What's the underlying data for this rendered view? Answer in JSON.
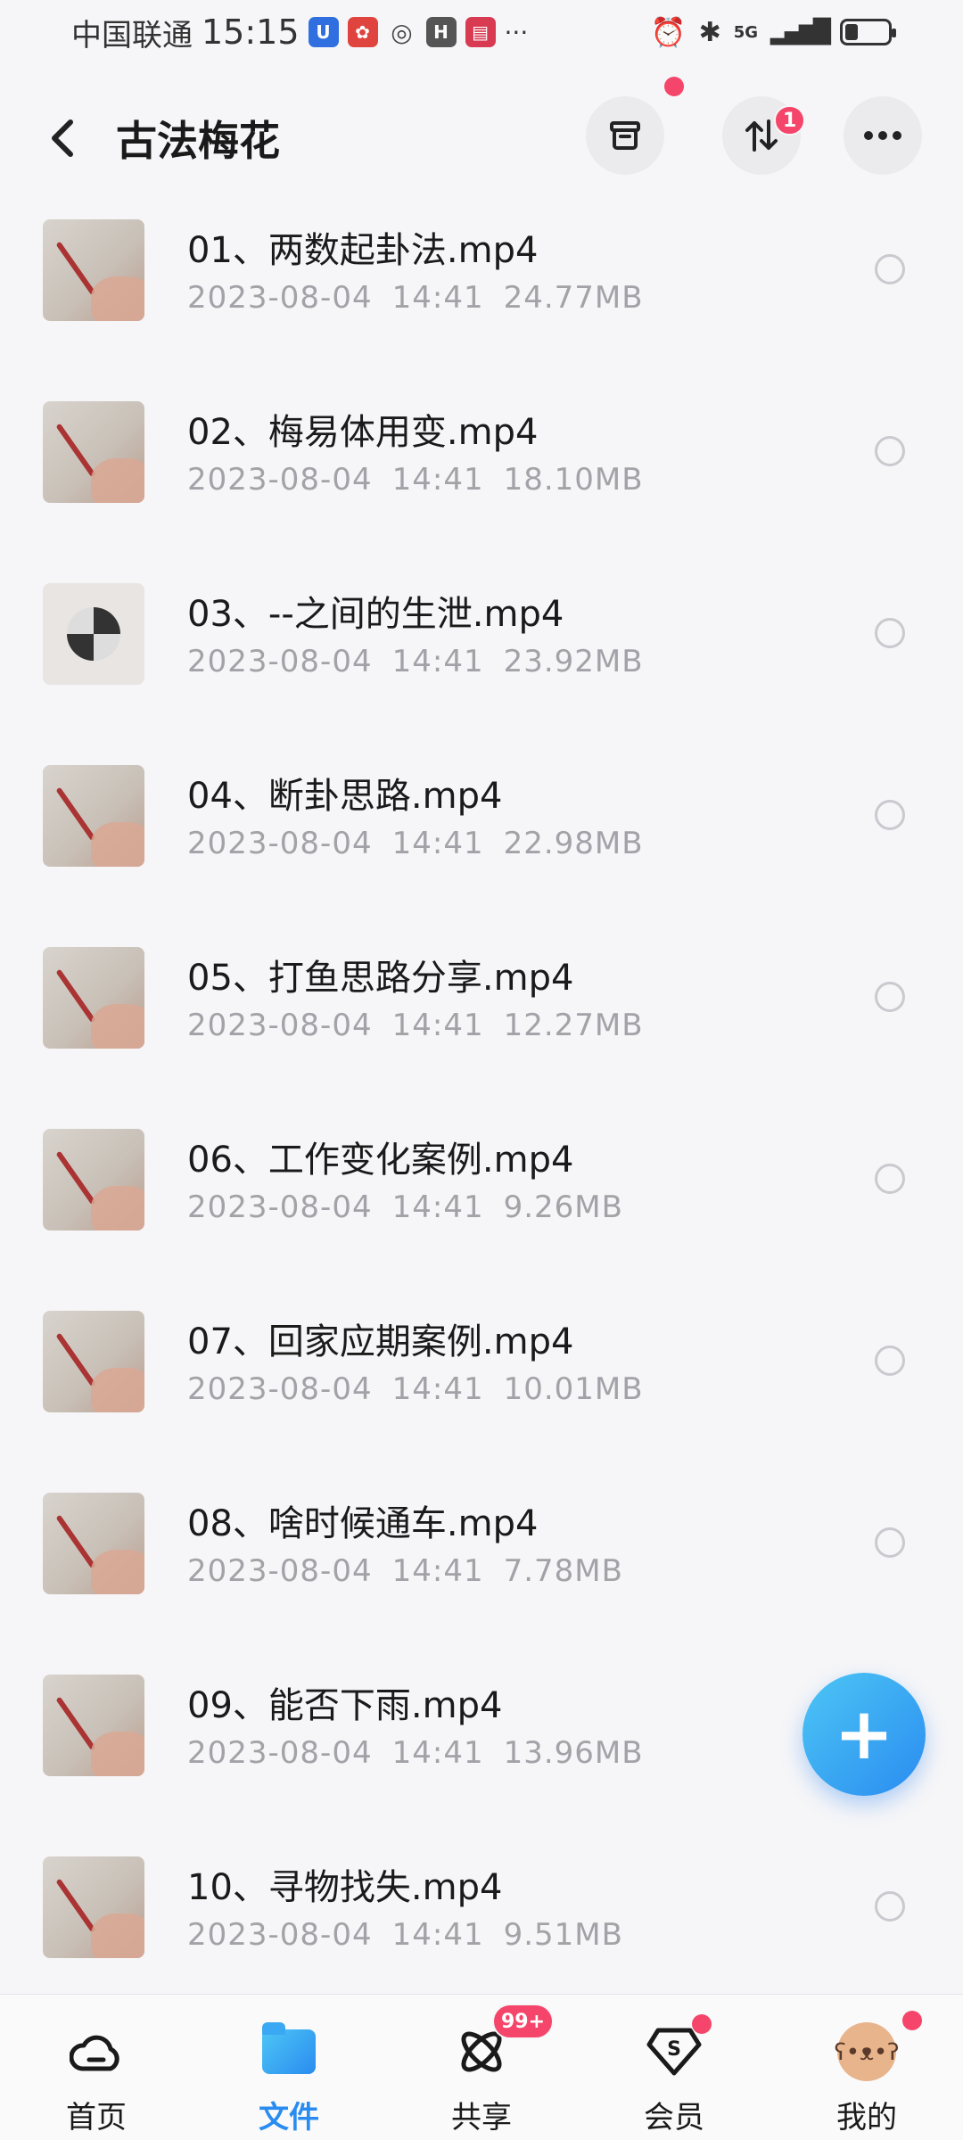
{
  "status_bar": {
    "carrier": "中国联通",
    "time": "15:15",
    "more": "···",
    "network": "5G"
  },
  "header": {
    "title": "古法梅花",
    "transfer_badge": "1"
  },
  "files": [
    {
      "name": "01、两数起卦法.mp4",
      "date": "2023-08-04",
      "time": "14:41",
      "size": "24.77MB"
    },
    {
      "name": "02、梅易体用变.mp4",
      "date": "2023-08-04",
      "time": "14:41",
      "size": "18.10MB"
    },
    {
      "name": "03、--之间的生泄.mp4",
      "date": "2023-08-04",
      "time": "14:41",
      "size": "23.92MB"
    },
    {
      "name": "04、断卦思路.mp4",
      "date": "2023-08-04",
      "time": "14:41",
      "size": "22.98MB"
    },
    {
      "name": "05、打鱼思路分享.mp4",
      "date": "2023-08-04",
      "time": "14:41",
      "size": "12.27MB"
    },
    {
      "name": "06、工作变化案例.mp4",
      "date": "2023-08-04",
      "time": "14:41",
      "size": "9.26MB"
    },
    {
      "name": "07、回家应期案例.mp4",
      "date": "2023-08-04",
      "time": "14:41",
      "size": "10.01MB"
    },
    {
      "name": "08、啥时候通车.mp4",
      "date": "2023-08-04",
      "time": "14:41",
      "size": "7.78MB"
    },
    {
      "name": "09、能否下雨.mp4",
      "date": "2023-08-04",
      "time": "14:41",
      "size": "13.96MB"
    },
    {
      "name": "10、寻物找失.mp4",
      "date": "2023-08-04",
      "time": "14:41",
      "size": "9.51MB"
    }
  ],
  "fab": {
    "label": "+"
  },
  "nav": {
    "home": "首页",
    "files": "文件",
    "share": "共享",
    "share_badge": "99+",
    "vip": "会员",
    "mine": "我的"
  },
  "colors": {
    "accent": "#2a8cf0",
    "badge": "#f5456a",
    "meta_text": "#a2a2a8"
  }
}
